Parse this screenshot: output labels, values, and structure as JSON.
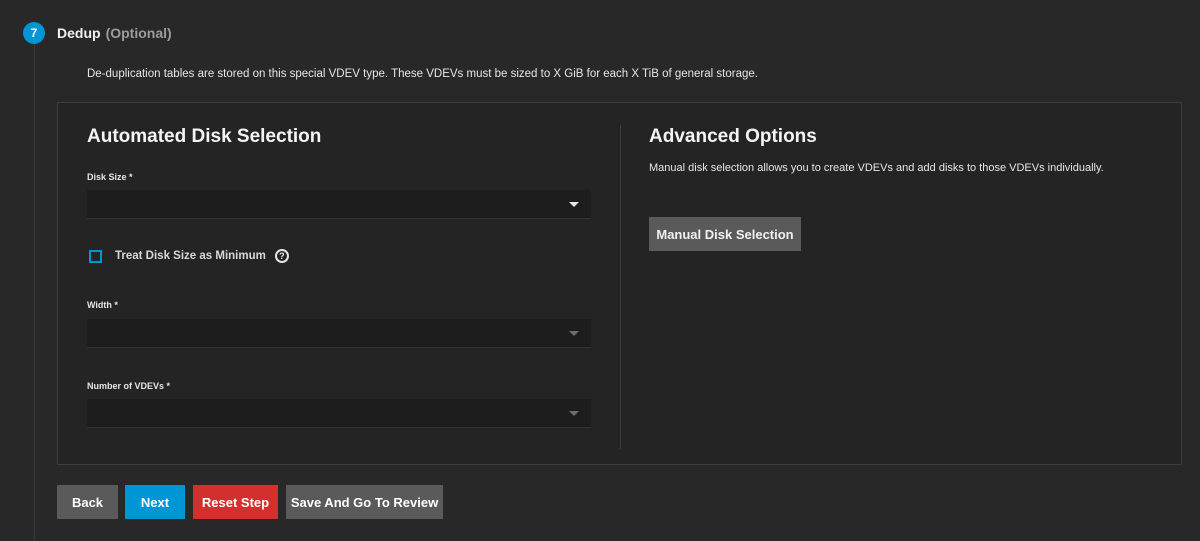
{
  "step": {
    "number": "7",
    "title": "Dedup",
    "optional": "(Optional)",
    "description": "De-duplication tables are stored on this special VDEV type. These VDEVs must be sized to X GiB for each X TiB of general storage."
  },
  "automated": {
    "title": "Automated Disk Selection",
    "disk_size_label": "Disk Size *",
    "disk_size_value": "",
    "treat_min_label": "Treat Disk Size as Minimum",
    "treat_min_checked": false,
    "help_icon": "help-circle-icon",
    "width_label": "Width *",
    "width_value": "",
    "vdevs_label": "Number of VDEVs *",
    "vdevs_value": ""
  },
  "advanced": {
    "title": "Advanced Options",
    "description": "Manual disk selection allows you to create VDEVs and add disks to those VDEVs individually.",
    "manual_button": "Manual Disk Selection"
  },
  "actions": {
    "back": "Back",
    "next": "Next",
    "reset": "Reset Step",
    "review": "Save And Go To Review"
  },
  "colors": {
    "accent": "#0095d5",
    "danger": "#d32f2f",
    "neutral_button": "#5a5a5a",
    "background": "#282828"
  }
}
